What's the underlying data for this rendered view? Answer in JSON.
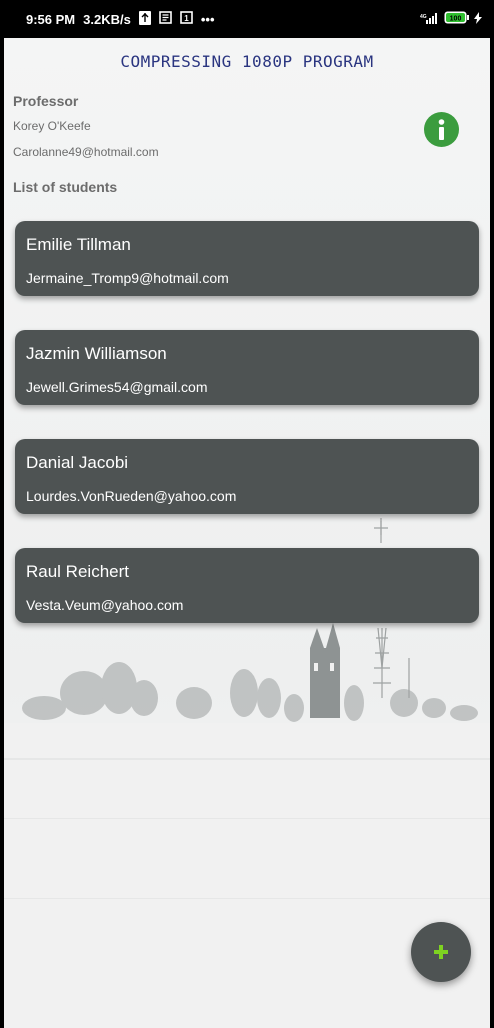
{
  "status_bar": {
    "time": "9:56 PM",
    "speed": "3.2KB/s",
    "more": "•••",
    "battery": "100",
    "icons": [
      "usb-icon",
      "news-icon",
      "sim-icon",
      "more-icon",
      "signal-icon",
      "battery-icon",
      "charging-icon"
    ]
  },
  "app": {
    "title": "COMPRESSING 1080P PROGRAM"
  },
  "professor": {
    "heading": "Professor",
    "name": "Korey O'Keefe",
    "email": "Carolanne49@hotmail.com"
  },
  "students": {
    "heading": "List of students",
    "items": [
      {
        "name": "Emilie Tillman",
        "email": "Jermaine_Tromp9@hotmail.com"
      },
      {
        "name": "Jazmin Williamson",
        "email": "Jewell.Grimes54@gmail.com"
      },
      {
        "name": "Danial Jacobi",
        "email": "Lourdes.VonRueden@yahoo.com"
      },
      {
        "name": "Raul Reichert",
        "email": "Vesta.Veum@yahoo.com"
      }
    ]
  },
  "colors": {
    "title": "#2a3580",
    "card_bg": "#4e5353",
    "info_button": "#3b9c3e",
    "fab_plus": "#7ed321"
  },
  "actions": {
    "info_icon": "info-icon",
    "add_icon": "plus-icon"
  }
}
